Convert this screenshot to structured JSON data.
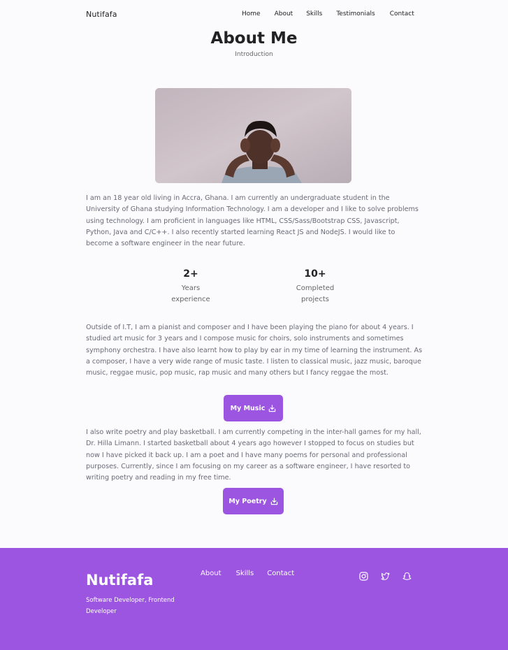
{
  "header": {
    "logo": "Nutifafa",
    "nav": [
      "Home",
      "About",
      "Skills",
      "Testimonials",
      "Contact"
    ]
  },
  "section": {
    "title": "About Me",
    "subtitle": "Introduction"
  },
  "about": {
    "paragraph1": "I am an 18 year old living in Accra, Ghana. I am currently an undergraduate student in the University of Ghana studying Information Technology. I am a developer and I like to solve problems using technology. I am proficient in languages like HTML, CSS/Sass/Bootstrap CSS, Javascript, Python, Java and C/C++. I also recently started learning React JS and NodeJS. I would like to become a software engineer in the near future.",
    "stats": [
      {
        "value": "2+",
        "label_line1": "Years",
        "label_line2": "experience"
      },
      {
        "value": "10+",
        "label_line1": "Completed",
        "label_line2": "projects"
      }
    ],
    "paragraph2": "Outside of I.T, I am a pianist and composer and I have been playing the piano for about 4 years. I studied art music for 3 years and I compose music for choirs, solo instruments and sometimes symphony orchestra. I have also learnt how to play by ear in my time of learning the instrument. As a composer, I have a very wide range of music taste. I listen to classical music, jazz music, baroque music, reggae music, pop music, rap music and many others but I fancy reggae the most.",
    "music_button": "My Music",
    "paragraph3": "I also write poetry and play basketball. I am currently competing in the inter-hall games for my hall, Dr. Hilla Limann. I started basketball about 4 years ago however I stopped to focus on studies but now I have picked it back up. I am a poet and I have many poems for personal and professional purposes. Currently, since I am focusing on my career as a software engineer, I have resorted to writing poetry and reading in my free time.",
    "poetry_button": "My Poetry"
  },
  "footer": {
    "brand": "Nutifafa",
    "tagline": "Software Developer, Frontend Developer",
    "links": [
      "About",
      "Skills",
      "Contact"
    ],
    "social_icons": [
      "instagram-icon",
      "twitter-icon",
      "snapchat-icon"
    ]
  },
  "colors": {
    "accent": "#9b55e0",
    "background": "#fbfbfe",
    "text_muted": "#6a6a75"
  }
}
